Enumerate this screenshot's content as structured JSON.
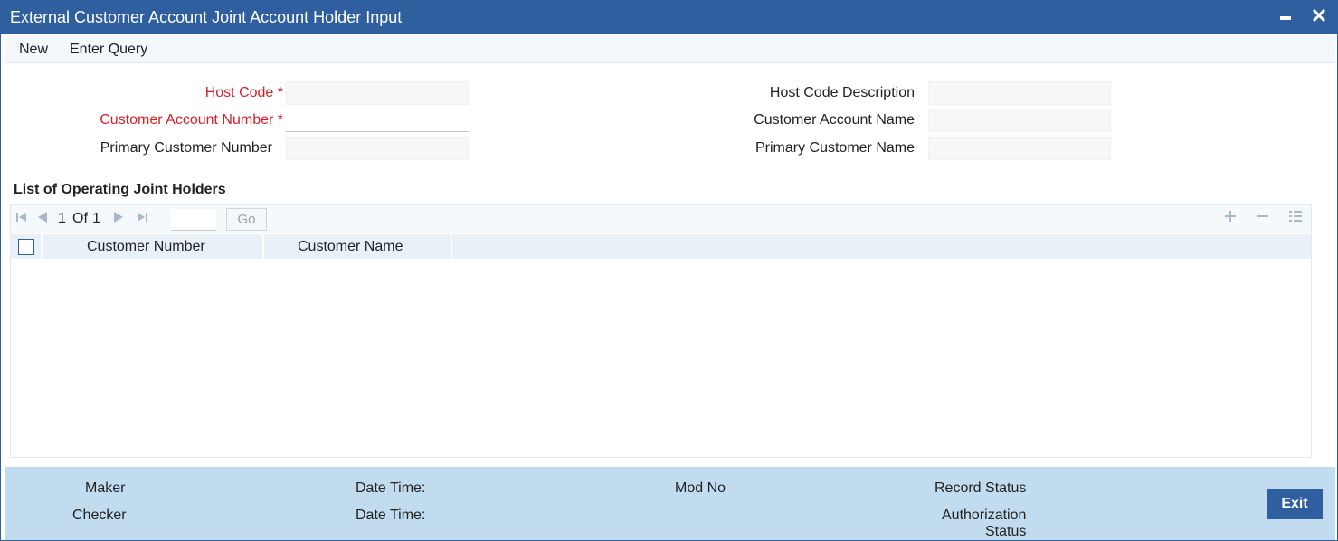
{
  "window": {
    "title": "External Customer Account Joint Account Holder Input",
    "minimize_glyph": "▬",
    "close_glyph": "✕"
  },
  "menu": {
    "new": "New",
    "enter_query": "Enter Query"
  },
  "form": {
    "host_code_label": "Host Code",
    "customer_account_number_label": "Customer Account Number",
    "primary_customer_number_label": "Primary Customer Number",
    "host_code_description_label": "Host Code Description",
    "customer_account_name_label": "Customer Account Name",
    "primary_customer_name_label": "Primary Customer Name",
    "required_marker": "*",
    "host_code_value": "",
    "customer_account_number_value": "",
    "primary_customer_number_value": "",
    "host_code_description_value": "",
    "customer_account_name_value": "",
    "primary_customer_name_value": ""
  },
  "grid": {
    "title": "List of Operating Joint Holders",
    "page_current": "1",
    "page_of": "Of",
    "page_total": "1",
    "go_label": "Go",
    "columns": [
      "Customer Number",
      "Customer Name"
    ],
    "rows": []
  },
  "icons": {
    "first": "first-page-icon",
    "prev": "previous-page-icon",
    "next": "next-page-icon",
    "last": "last-page-icon",
    "add": "add-row-icon",
    "delete": "delete-row-icon",
    "view": "single-view-icon"
  },
  "footer": {
    "maker": "Maker",
    "checker": "Checker",
    "date_time_1": "Date Time:",
    "date_time_2": "Date Time:",
    "mod_no": "Mod No",
    "record_status": "Record Status",
    "authorization_status_line1": "Authorization",
    "authorization_status_line2": "Status",
    "exit": "Exit"
  },
  "colors": {
    "titlebar": "#2f5f9e",
    "required": "#d6202a",
    "footer": "#c1dcef"
  }
}
